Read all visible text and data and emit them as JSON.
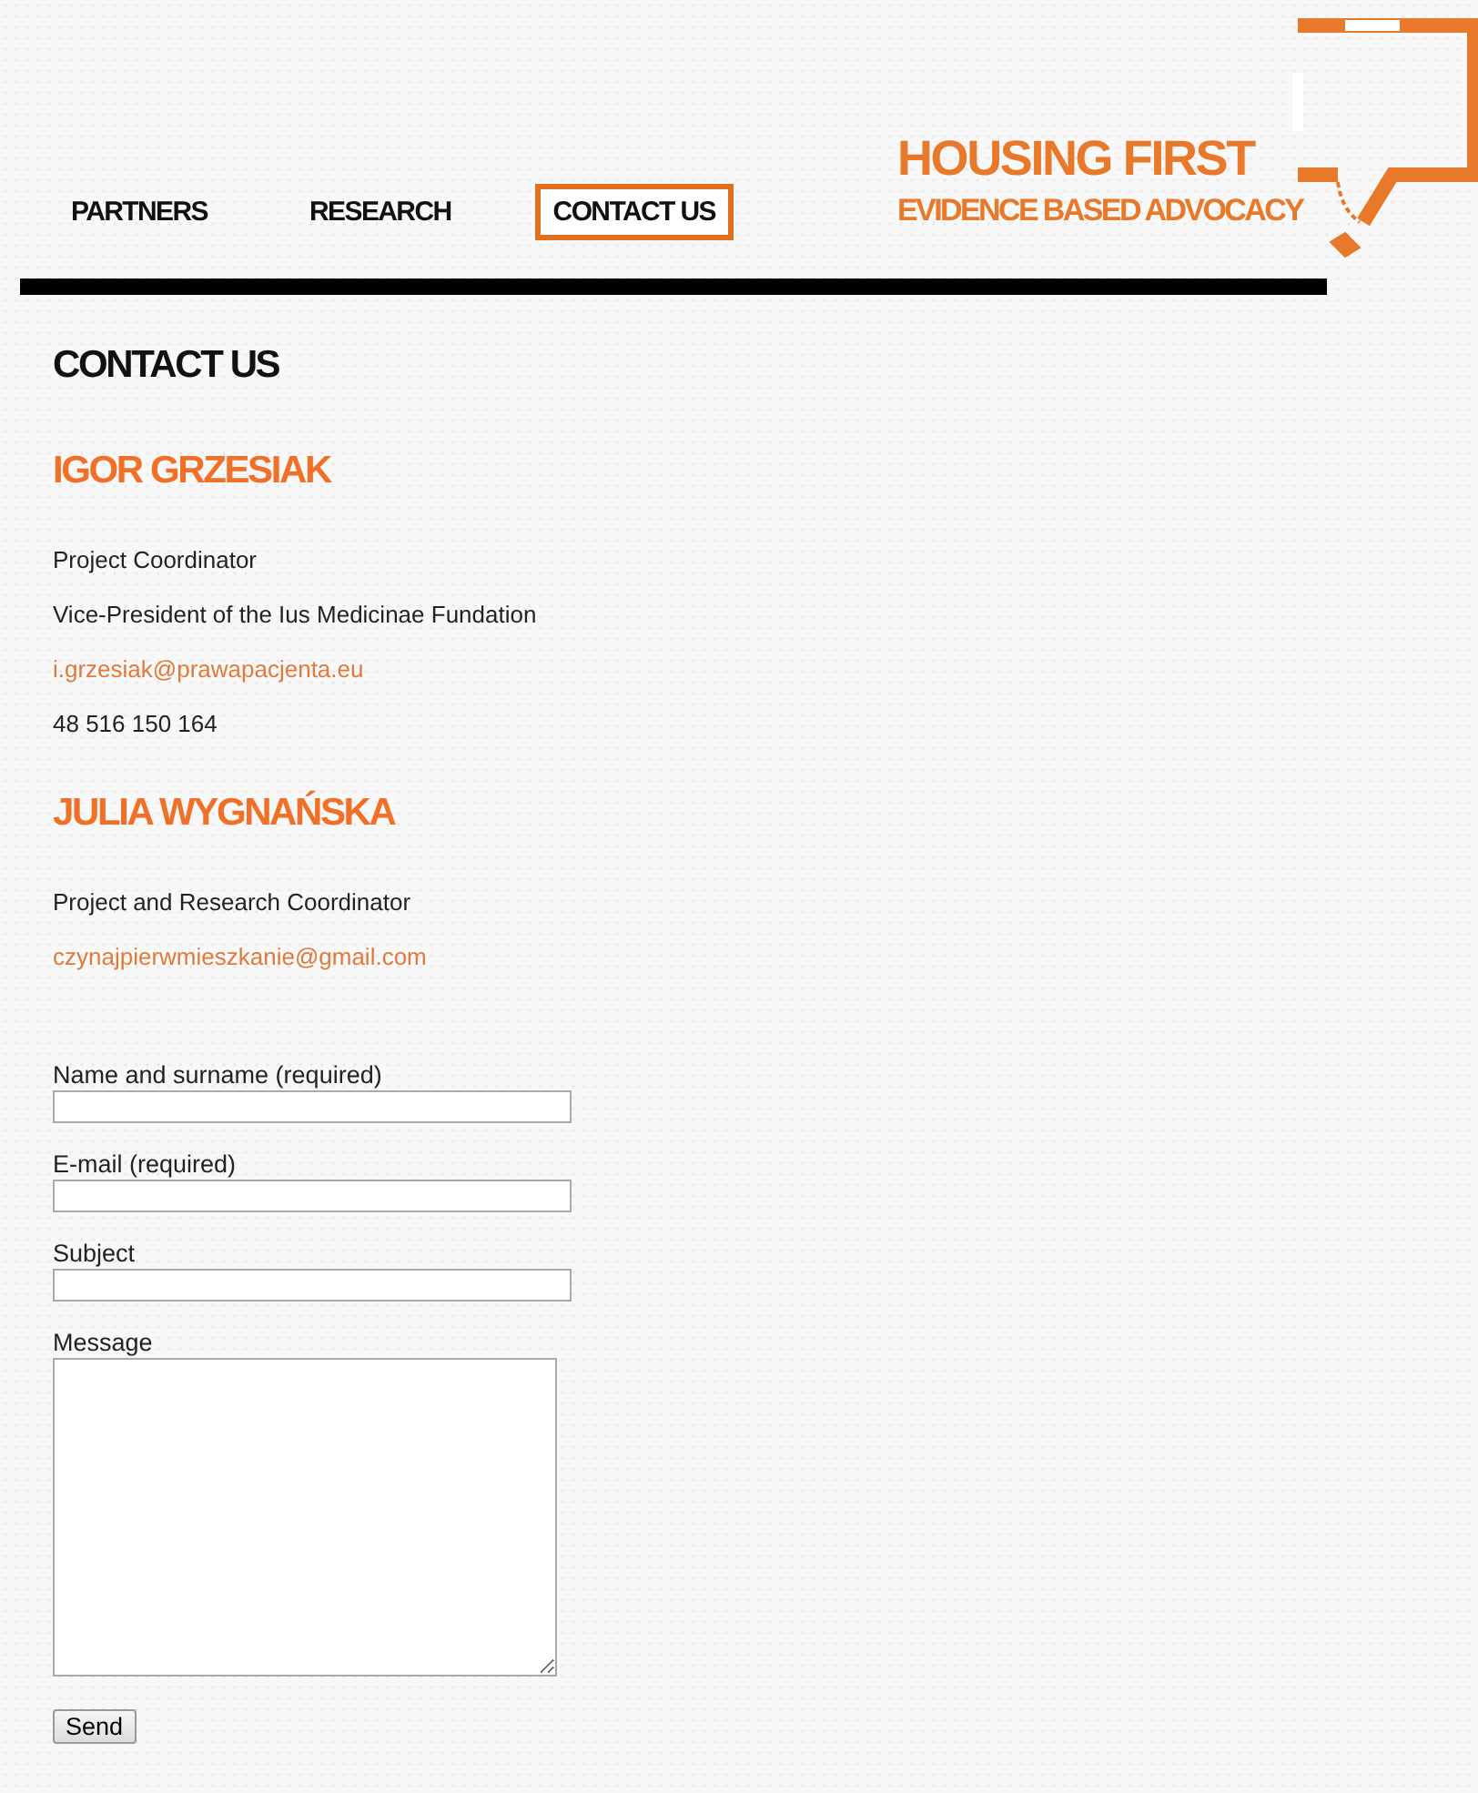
{
  "nav": [
    {
      "label": "PARTNERS",
      "selected": false
    },
    {
      "label": "RESEARCH",
      "selected": false
    },
    {
      "label": "CONTACT US",
      "selected": true
    }
  ],
  "logo": {
    "title": "HOUSING FIRST",
    "subtitle": "EVIDENCE BASED ADVOCACY"
  },
  "heading": "CONTACT US",
  "contacts": [
    {
      "name": "IGOR GRZESIAK",
      "lines": [
        {
          "kind": "text",
          "text": "Project Coordinator"
        },
        {
          "kind": "text",
          "text": "Vice-President of the Ius Medicinae Fundation"
        },
        {
          "kind": "email",
          "text": "i.grzesiak@prawapacjenta.eu"
        },
        {
          "kind": "text",
          "text": "48 516 150 164"
        }
      ]
    },
    {
      "name": "JULIA WYGNAŃSKA",
      "lines": [
        {
          "kind": "text",
          "text": "Project and Research Coordinator"
        },
        {
          "kind": "email",
          "text": "czynajpierwmieszkanie@gmail.com"
        }
      ]
    }
  ],
  "form": {
    "fields": [
      {
        "kind": "input",
        "label": "Name and surname (required)"
      },
      {
        "kind": "input",
        "label": "E-mail (required)"
      },
      {
        "kind": "input",
        "label": "Subject"
      },
      {
        "kind": "textarea",
        "label": "Message"
      }
    ],
    "button": "Send"
  }
}
